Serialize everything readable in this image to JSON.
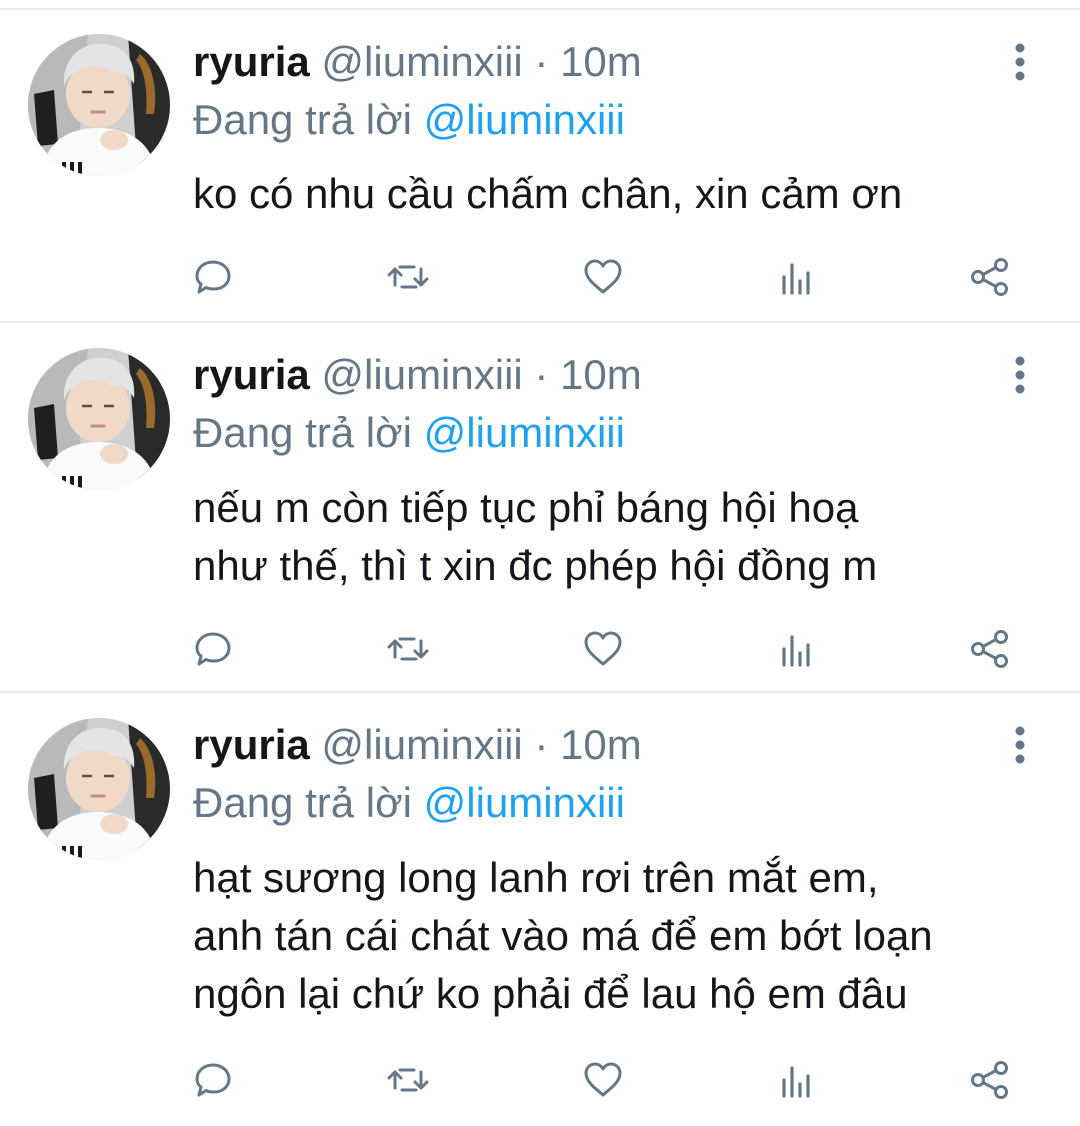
{
  "feed": {
    "tweets": [
      {
        "display_name": "ryuria",
        "handle": "@liuminxiii",
        "separator": "·",
        "time": "10m",
        "reply_prefix": "Đang trả lời",
        "reply_to": "@liuminxiii",
        "text": "ko có nhu cầu chấm chân, xin cảm ơn"
      },
      {
        "display_name": "ryuria",
        "handle": "@liuminxiii",
        "separator": "·",
        "time": "10m",
        "reply_prefix": "Đang trả lời",
        "reply_to": "@liuminxiii",
        "text": "nếu m còn tiếp tục phỉ báng hội hoạ\nnhư thế, thì t xin đc phép hội đồng m"
      },
      {
        "display_name": "ryuria",
        "handle": "@liuminxiii",
        "separator": "·",
        "time": "10m",
        "reply_prefix": "Đang trả lời",
        "reply_to": "@liuminxiii",
        "text": "hạt sương long lanh rơi trên mắt em,\nanh tán cái chát vào má để em bớt loạn\nngôn lại chứ ko phải để lau hộ em đâu"
      }
    ],
    "action_icons": [
      "reply-icon",
      "retweet-icon",
      "like-icon",
      "analytics-icon",
      "share-icon"
    ],
    "colors": {
      "text": "#14171a",
      "secondary": "#657786",
      "link": "#1da1f2",
      "divider": "#e6ecf0",
      "icon": "#657786"
    }
  }
}
